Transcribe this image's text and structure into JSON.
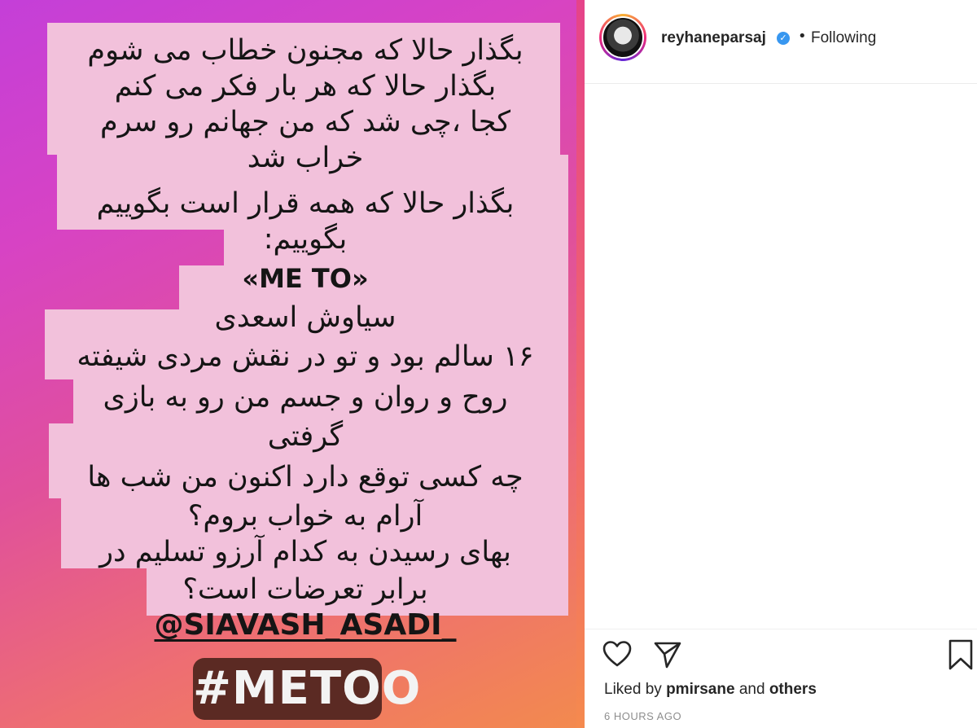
{
  "post": {
    "lines": [
      "بگذار حالا که مجنون خطاب می شوم",
      "بگذار حالا که هر بار فکر می کنم",
      "کجا ،چی شد که من جهانم رو سرم",
      "خراب شد",
      "بگذار حالا که همه قرار است بگوییم",
      "بگوییم:",
      "«ME TO»",
      "سیاوش اسعدی",
      "۱۶ سالم بود و تو در نقش مردی شیفته",
      "روح و روان و جسم من رو به بازی",
      "گرفتی",
      "چه کسی توقع دارد اکنون من شب ها",
      "آرام به خواب بروم؟",
      "بهای رسیدن به کدام آرزو تسلیم در",
      "برابر تعرضات است؟",
      "@SIAVASH_ASADI_"
    ],
    "hashtag": "#METOO",
    "colors": {
      "box": "#f2c1db",
      "gradient_start": "#c43fd8",
      "gradient_end": "#f38a4e",
      "pill": "#5b2a23"
    }
  },
  "header": {
    "username": "reyhaneparsaj",
    "verified_icon": "verified-badge-icon",
    "separator": "•",
    "follow_status": "Following"
  },
  "actions": {
    "like_icon": "heart-icon",
    "share_icon": "send-icon",
    "save_icon": "bookmark-icon"
  },
  "likes": {
    "prefix": "Liked by",
    "user": "pmirsane",
    "connector": "and",
    "others": "others"
  },
  "timestamp": "6 HOURS AGO"
}
